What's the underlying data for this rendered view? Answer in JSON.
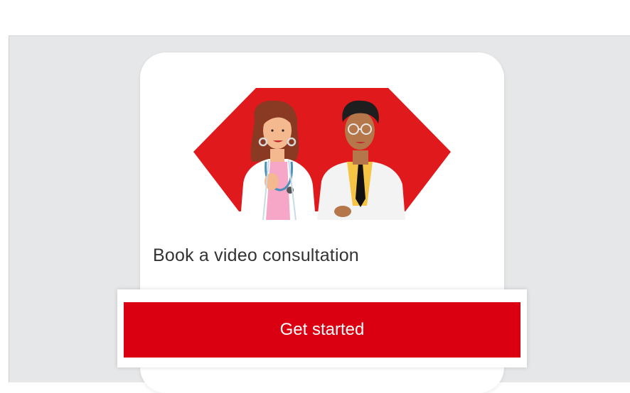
{
  "card": {
    "title": "Book a video consultation",
    "button_label": "Get started",
    "illustration_icon": "doctors-illustration-icon"
  },
  "colors": {
    "brand_red": "#db0011",
    "hexagon_red": "#e0191d",
    "panel_gray": "#e6e7e8",
    "text": "#333333"
  }
}
